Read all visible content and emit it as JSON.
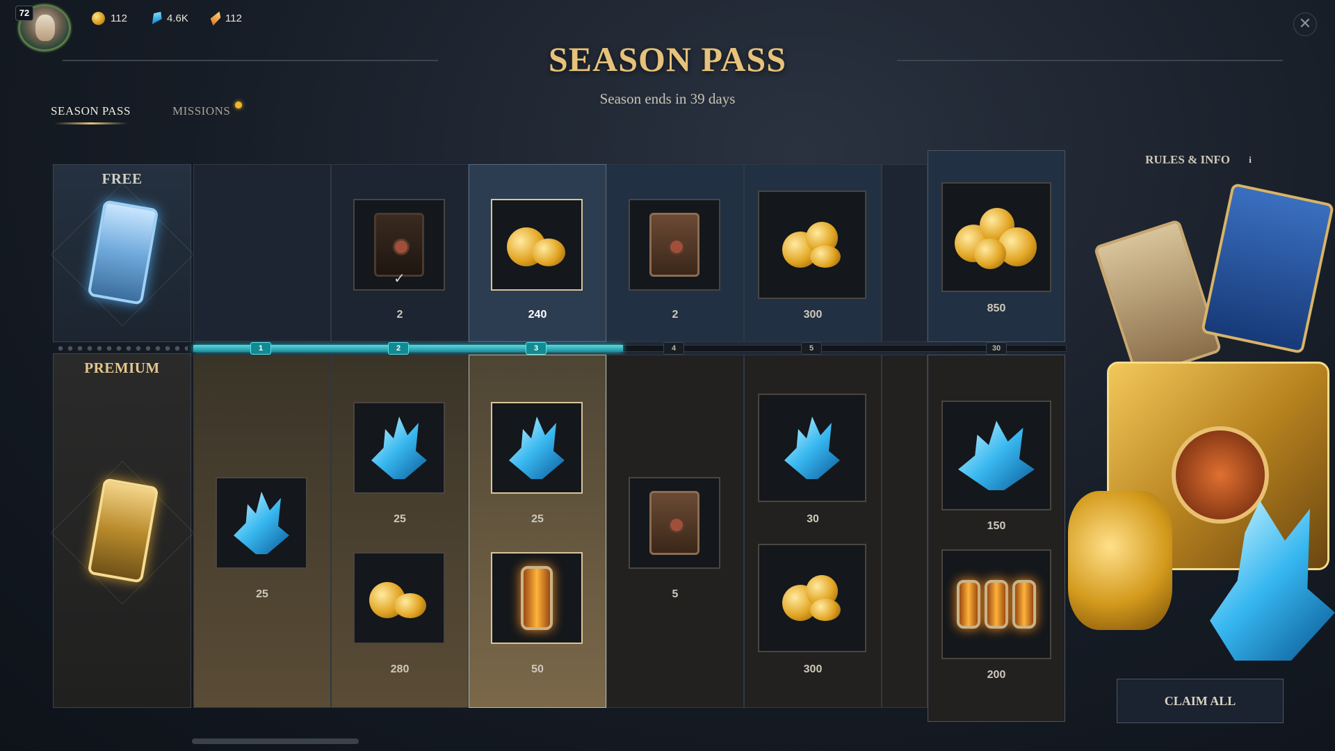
{
  "header": {
    "level": "72",
    "currencies": [
      {
        "icon": "gold-coin-icon",
        "value": "112"
      },
      {
        "icon": "blue-crystal-icon",
        "value": "4.6K"
      },
      {
        "icon": "orange-shard-icon",
        "value": "112"
      }
    ],
    "close": "✕"
  },
  "title": "SEASON PASS",
  "subtitle": "Season ends in 39 days",
  "tabs": [
    {
      "label": "SEASON PASS",
      "active": true
    },
    {
      "label": "MISSIONS",
      "notification": true
    }
  ],
  "rules": {
    "label": "RULES & INFO",
    "info": "i"
  },
  "tracks": {
    "free_label": "FREE",
    "premium_label": "PREMIUM"
  },
  "levels": [
    "1",
    "2",
    "3",
    "4",
    "5",
    "30"
  ],
  "progress_current_level": 3,
  "free_rewards": [
    {
      "level": "1",
      "icon": null,
      "value": ""
    },
    {
      "level": "2",
      "icon": "card-pack-icon",
      "value": "2",
      "claimed": true
    },
    {
      "level": "3",
      "icon": "gold-coins-icon",
      "value": "240",
      "selected": true
    },
    {
      "level": "4",
      "icon": "card-pack-icon",
      "value": "2"
    },
    {
      "level": "5",
      "icon": "gold-coins-icon",
      "value": "300"
    },
    {
      "level": "30",
      "icon": "gold-coins-pile-icon",
      "value": "850"
    }
  ],
  "premium_rewards": [
    {
      "level": "1",
      "items": [
        {
          "icon": "blue-crystal-icon",
          "value": "25"
        }
      ]
    },
    {
      "level": "2",
      "items": [
        {
          "icon": "blue-crystal-icon",
          "value": "25"
        },
        {
          "icon": "gold-coins-icon",
          "value": "280"
        }
      ]
    },
    {
      "level": "3",
      "items": [
        {
          "icon": "blue-crystal-icon",
          "value": "25"
        },
        {
          "icon": "lantern-icon",
          "value": "50"
        }
      ]
    },
    {
      "level": "4",
      "items": [
        {
          "icon": "card-pack-icon",
          "value": "5"
        }
      ]
    },
    {
      "level": "5",
      "items": [
        {
          "icon": "blue-crystal-icon",
          "value": "30"
        },
        {
          "icon": "gold-coins-icon",
          "value": "300"
        }
      ]
    },
    {
      "level": "30",
      "items": [
        {
          "icon": "blue-crystal-cluster-icon",
          "value": "150"
        },
        {
          "icon": "lantern-bundle-icon",
          "value": "200"
        }
      ]
    }
  ],
  "claim_all": "CLAIM ALL",
  "colors": {
    "accent_gold": "#e7c27a",
    "progress_teal": "#2ac9d6",
    "notification": "#f3b62a"
  }
}
